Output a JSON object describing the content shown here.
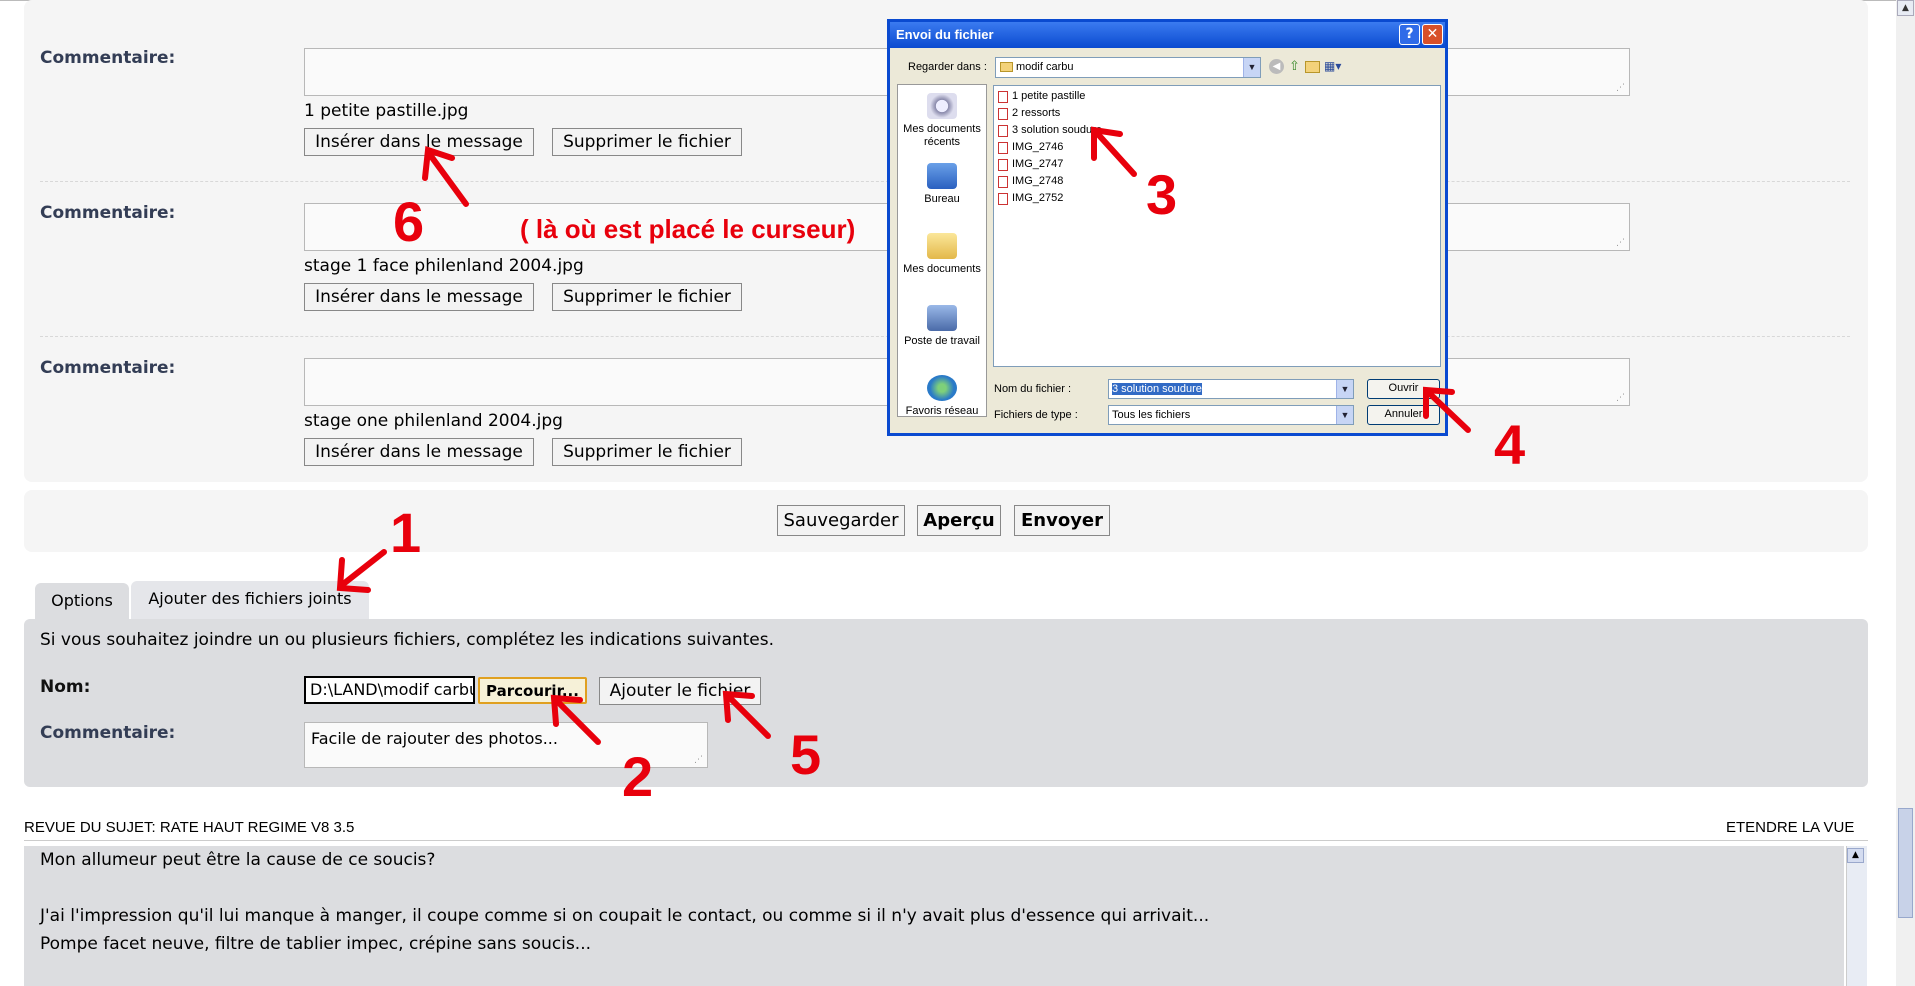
{
  "attachments": [
    {
      "comment_label": "Commentaire:",
      "filename": "1 petite pastille.jpg",
      "insert_label": "Insérer dans le message",
      "delete_label": "Supprimer le fichier"
    },
    {
      "comment_label": "Commentaire:",
      "filename": "stage 1 face philenland 2004.jpg",
      "insert_label": "Insérer dans le message",
      "delete_label": "Supprimer le fichier"
    },
    {
      "comment_label": "Commentaire:",
      "filename": "stage one philenland 2004.jpg",
      "insert_label": "Insérer dans le message",
      "delete_label": "Supprimer le fichier"
    }
  ],
  "submit": {
    "save": "Sauvegarder",
    "preview": "Aperçu",
    "send": "Envoyer"
  },
  "tabs": [
    {
      "label": "Options"
    },
    {
      "label": "Ajouter des fichiers joints"
    }
  ],
  "attach_form": {
    "intro": "Si vous souhaitez joindre un ou plusieurs fichiers, complétez les indications suivantes.",
    "name_label": "Nom:",
    "file_value": "D:\\LAND\\modif carbu\\",
    "browse": "Parcourir...",
    "add_file": "Ajouter le fichier",
    "comment_label": "Commentaire:",
    "comment_value": "Facile de rajouter des photos..."
  },
  "review": {
    "title": "REVUE DU SUJET: RATE HAUT REGIME V8 3.5",
    "expand": "ETENDRE LA VUE",
    "lines": [
      "Mon allumeur peut être la cause de ce soucis?",
      "",
      "J'ai l'impression qu'il lui manque à manger, il coupe comme si on coupait le contact, ou comme si il n'y avait plus d'essence qui arrivait...",
      "Pompe facet neuve, filtre de tablier impec, crépine sans soucis..."
    ]
  },
  "dialog": {
    "title": "Envoi du fichier",
    "help": "?",
    "close": "✕",
    "look_in_label": "Regarder dans :",
    "look_in_value": "modif carbu",
    "places": [
      {
        "label": "Mes documents récents",
        "icon": "recent-docs-icon"
      },
      {
        "label": "Bureau",
        "icon": "desktop-icon"
      },
      {
        "label": "Mes documents",
        "icon": "my-documents-icon"
      },
      {
        "label": "Poste de travail",
        "icon": "computer-icon"
      },
      {
        "label": "Favoris réseau",
        "icon": "network-icon"
      }
    ],
    "files": [
      "1 petite pastille",
      "2 ressorts",
      "3 solution soudure",
      "IMG_2746",
      "IMG_2747",
      "IMG_2748",
      "IMG_2752"
    ],
    "filename_label": "Nom du fichier :",
    "filename_value": "3 solution soudure",
    "filetype_label": "Fichiers de type :",
    "filetype_value": "Tous les fichiers",
    "open": "Ouvrir",
    "cancel": "Annuler"
  },
  "annotations": {
    "n1": "1",
    "n2": "2",
    "n3": "3",
    "n4": "4",
    "n5": "5",
    "n6": "6",
    "note6": "( là où est placé le curseur)",
    "color": "#e8000c"
  }
}
